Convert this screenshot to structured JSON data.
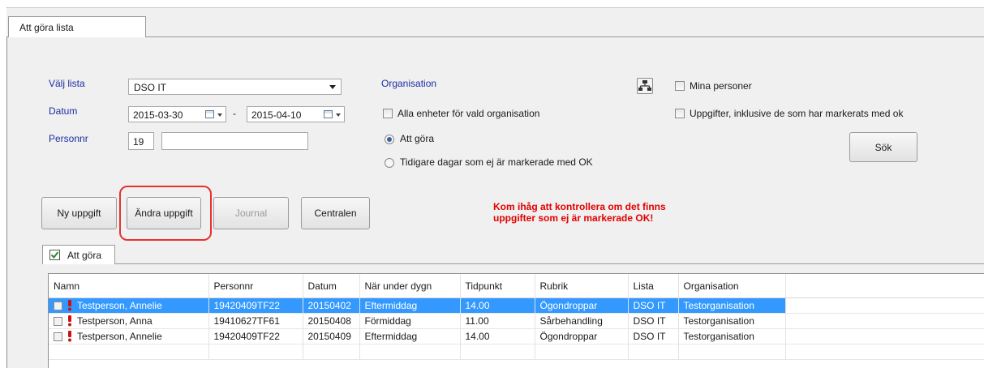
{
  "window": {
    "tab_label": "Att göra lista"
  },
  "filters": {
    "list_label": "Välj lista",
    "list_value": "DSO IT",
    "date_label": "Datum",
    "date_from": "2015-03-30",
    "date_separator": "-",
    "date_to": "2015-04-10",
    "personnr_label": "Personnr",
    "personnr_prefix": "19",
    "personnr_value": "",
    "organisation_label": "Organisation",
    "all_units_label": "Alla enheter för vald organisation",
    "radio_todo_label": "Att göra",
    "radio_earlier_label": "Tidigare dagar som ej är markerade med OK",
    "my_persons_label": "Mina personer",
    "include_ok_label": "Uppgifter, inklusive de som har markerats med ok",
    "search_button": "Sök"
  },
  "actions": {
    "new_task": "Ny uppgift",
    "edit_task": "Ändra uppgift",
    "journal": "Journal",
    "central": "Centralen"
  },
  "warning": {
    "line1": "Kom ihåg att kontrollera om det finns",
    "line2": "uppgifter som ej är markerade OK!"
  },
  "subtab": {
    "label": "Att göra"
  },
  "grid": {
    "columns": [
      "Namn",
      "Personnr",
      "Datum",
      "När under dygn",
      "Tidpunkt",
      "Rubrik",
      "Lista",
      "Organisation"
    ],
    "rows": [
      [
        "Testperson, Annelie",
        "19420409TF22",
        "20150402",
        "Eftermiddag",
        "14.00",
        "Ögondroppar",
        "DSO IT",
        "Testorganisation"
      ],
      [
        "Testperson, Anna",
        "19410627TF61",
        "20150408",
        "Förmiddag",
        "11.00",
        "Sårbehandling",
        "DSO IT",
        "Testorganisation"
      ],
      [
        "Testperson, Annelie",
        "19420409TF22",
        "20150409",
        "Eftermiddag",
        "14.00",
        "Ögondroppar",
        "DSO IT",
        "Testorganisation"
      ]
    ],
    "selected_row": 0
  },
  "colors": {
    "selection": "#3399ff",
    "warning": "#e30000",
    "label_blue": "#1c2ea2",
    "highlight_circle": "#e8322f"
  }
}
